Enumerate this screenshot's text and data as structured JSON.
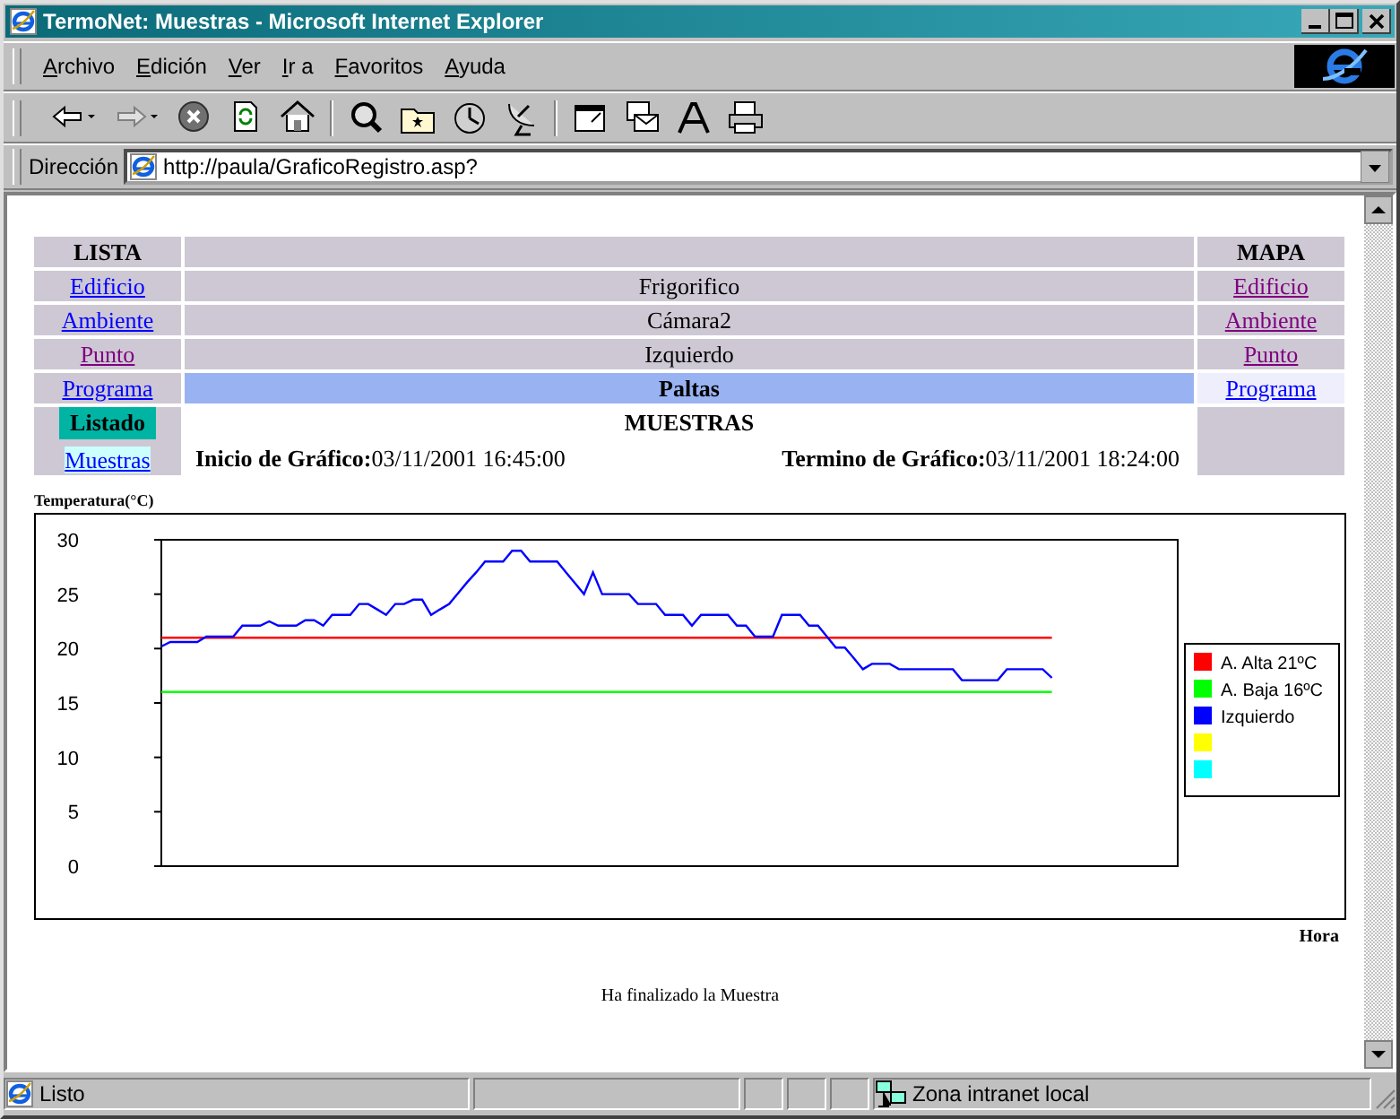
{
  "window": {
    "title": "TermoNet: Muestras - Microsoft Internet Explorer"
  },
  "menu": [
    "Archivo",
    "Edición",
    "Ver",
    "Ir a",
    "Favoritos",
    "Ayuda"
  ],
  "address": {
    "label": "Dirección",
    "url": "http://paula/GraficoRegistro.asp?"
  },
  "nav": {
    "lista_title": "LISTA",
    "mapa_title": "MAPA",
    "rows": [
      {
        "lista": {
          "label": "Edificio",
          "visited": false
        },
        "value": "Frigorifico",
        "selected": false,
        "mapa": {
          "label": "Edificio",
          "visited": true,
          "selected": false
        }
      },
      {
        "lista": {
          "label": "Ambiente",
          "visited": false
        },
        "value": "Cámara2",
        "selected": false,
        "mapa": {
          "label": "Ambiente",
          "visited": true,
          "selected": false
        }
      },
      {
        "lista": {
          "label": "Punto",
          "visited": true
        },
        "value": "Izquierdo",
        "selected": false,
        "mapa": {
          "label": "Punto",
          "visited": true,
          "selected": false
        }
      },
      {
        "lista": {
          "label": "Programa",
          "visited": false
        },
        "value": "Paltas",
        "selected": true,
        "mapa": {
          "label": "Programa",
          "visited": false,
          "selected": true
        }
      }
    ],
    "listado": {
      "title": "Listado",
      "link": {
        "label": "Muestras",
        "visited": false,
        "selected": true
      }
    },
    "heading": "MUESTRAS",
    "start": {
      "label": "Inicio de Gráfico:",
      "value": "03/11/2001 16:45:00"
    },
    "end": {
      "label": "Termino de Gráfico:",
      "value": "03/11/2001 18:24:00"
    }
  },
  "chart": {
    "chart_data": {
      "type": "line",
      "ylabel": "Temperatura(°C)",
      "xlabel": "Hora",
      "legend": "right",
      "ylim": [
        0,
        30
      ],
      "yticks": [
        0,
        5,
        10,
        15,
        20,
        25,
        30
      ],
      "categories": [
        null,
        null,
        null,
        null,
        null,
        null,
        null,
        null,
        null,
        null,
        null,
        null,
        null,
        null,
        null,
        null,
        null,
        null,
        null,
        null,
        null,
        null,
        null,
        null,
        null,
        null,
        null,
        null,
        null,
        null,
        null,
        null,
        null,
        null,
        null,
        null,
        null,
        null,
        null,
        null,
        null,
        null,
        null,
        null,
        null,
        null,
        null,
        null,
        null,
        null,
        null,
        null,
        null,
        null,
        null,
        null,
        null,
        null,
        null,
        null,
        null,
        null,
        null,
        null,
        null,
        null,
        null,
        null,
        null,
        null,
        null,
        null,
        null,
        null,
        null,
        null,
        null,
        null,
        null,
        null,
        null,
        null,
        null,
        null,
        null,
        null,
        null,
        null,
        null,
        null,
        null,
        null,
        null,
        null,
        null,
        null,
        null,
        null,
        null,
        null
      ],
      "series": [
        {
          "name": "A. Alta 21ºC",
          "color": "#ff0000",
          "values": [
            21,
            21,
            21,
            21,
            21,
            21,
            21,
            21,
            21,
            21,
            21,
            21,
            21,
            21,
            21,
            21,
            21,
            21,
            21,
            21,
            21,
            21,
            21,
            21,
            21,
            21,
            21,
            21,
            21,
            21,
            21,
            21,
            21,
            21,
            21,
            21,
            21,
            21,
            21,
            21,
            21,
            21,
            21,
            21,
            21,
            21,
            21,
            21,
            21,
            21,
            21,
            21,
            21,
            21,
            21,
            21,
            21,
            21,
            21,
            21,
            21,
            21,
            21,
            21,
            21,
            21,
            21,
            21,
            21,
            21,
            21,
            21,
            21,
            21,
            21,
            21,
            21,
            21,
            21,
            21,
            21,
            21,
            21,
            21,
            21,
            21,
            21,
            21,
            21,
            21,
            21,
            21,
            21,
            21,
            21,
            21,
            21,
            21,
            21,
            21
          ]
        },
        {
          "name": "A. Baja 16ºC",
          "color": "#00ff00",
          "values": [
            16,
            16,
            16,
            16,
            16,
            16,
            16,
            16,
            16,
            16,
            16,
            16,
            16,
            16,
            16,
            16,
            16,
            16,
            16,
            16,
            16,
            16,
            16,
            16,
            16,
            16,
            16,
            16,
            16,
            16,
            16,
            16,
            16,
            16,
            16,
            16,
            16,
            16,
            16,
            16,
            16,
            16,
            16,
            16,
            16,
            16,
            16,
            16,
            16,
            16,
            16,
            16,
            16,
            16,
            16,
            16,
            16,
            16,
            16,
            16,
            16,
            16,
            16,
            16,
            16,
            16,
            16,
            16,
            16,
            16,
            16,
            16,
            16,
            16,
            16,
            16,
            16,
            16,
            16,
            16,
            16,
            16,
            16,
            16,
            16,
            16,
            16,
            16,
            16,
            16,
            16,
            16,
            16,
            16,
            16,
            16,
            16,
            16,
            16,
            16
          ]
        },
        {
          "name": "Izquierdo",
          "color": "#0000ff",
          "values": [
            20.2,
            20.6,
            20.6,
            20.6,
            20.6,
            21.1,
            21.1,
            21.1,
            21.1,
            22.1,
            22.1,
            22.1,
            22.5,
            22.1,
            22.1,
            22.1,
            22.6,
            22.6,
            22.1,
            23.1,
            23.1,
            23.1,
            24.1,
            24.1,
            23.6,
            23.1,
            24.1,
            24.1,
            24.5,
            24.5,
            23.1,
            23.6,
            24.1,
            25.1,
            26.1,
            27,
            28,
            28,
            28,
            29,
            29,
            28,
            28,
            28,
            28,
            27,
            26,
            25,
            27,
            25,
            25,
            25,
            25,
            24.1,
            24.1,
            24.1,
            23.1,
            23.1,
            23.1,
            22.1,
            23.1,
            23.1,
            23.1,
            23.1,
            22.1,
            22.1,
            21.1,
            21.1,
            21.1,
            23.1,
            23.1,
            23.1,
            22.1,
            22.1,
            21.1,
            20.1,
            20.1,
            19.1,
            18.1,
            18.6,
            18.6,
            18.6,
            18.1,
            18.1,
            18.1,
            18.1,
            18.1,
            18.1,
            18.1,
            17.1,
            17.1,
            17.1,
            17.1,
            17.1,
            18.1,
            18.1,
            18.1,
            18.1,
            18.1,
            17.3
          ]
        }
      ]
    },
    "legend_extra": [
      {
        "color": "#ffff00"
      },
      {
        "color": "#00ffff"
      }
    ]
  },
  "message": "Ha finalizado la Muestra",
  "status": {
    "text": "Listo",
    "zone": "Zona intranet local"
  }
}
